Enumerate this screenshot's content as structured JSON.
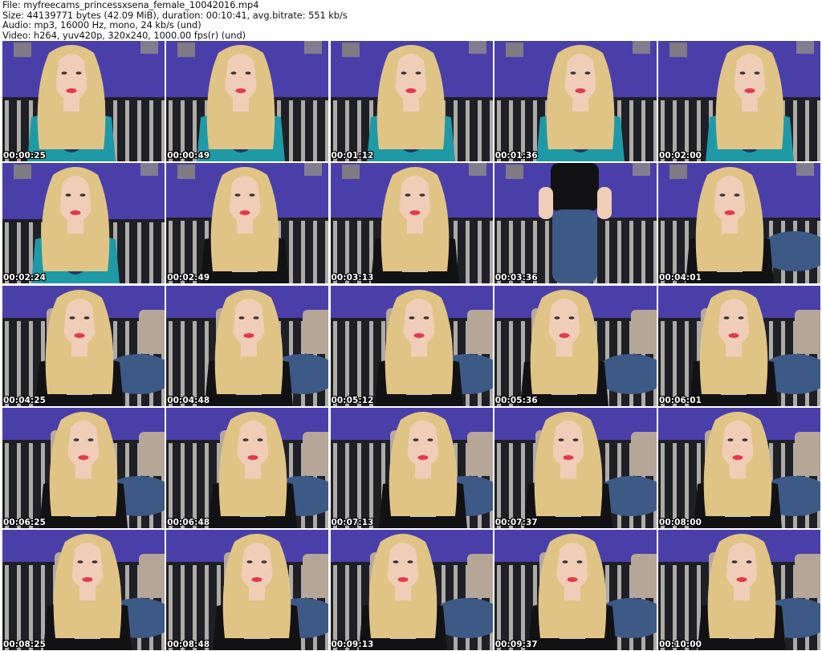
{
  "header": {
    "file": "File: myfreecams_princessxsena_female_10042016.mp4",
    "size": "Size: 44139771 bytes (42.09 MiB), duration: 00:10:41, avg.bitrate: 551 kb/s",
    "audio": "Audio: mp3, 16000 Hz, mono, 24 kb/s (und)",
    "video": "Video: h264, yuv420p, 320x240, 1000.00 fps(r) (und)"
  },
  "colors": {
    "wall": "#4a3fa8",
    "sofa_dark": "#1f1f26",
    "sofa_stripe": "#c9c4bd",
    "hair": "#e0c486",
    "skin": "#f0cdb7",
    "teal_shirt": "#1e9aa6",
    "black_shirt": "#121214",
    "jeans": "#3d5a86",
    "lips": "#e23a4c",
    "timestamp": "#ffffff"
  },
  "thumbnails": [
    {
      "time": "00:00:25",
      "outfit": "teal"
    },
    {
      "time": "00:00:49",
      "outfit": "teal"
    },
    {
      "time": "00:01:12",
      "outfit": "teal"
    },
    {
      "time": "00:01:36",
      "outfit": "teal"
    },
    {
      "time": "00:02:00",
      "outfit": "teal"
    },
    {
      "time": "00:02:24",
      "outfit": "teal"
    },
    {
      "time": "00:02:49",
      "outfit": "black"
    },
    {
      "time": "00:03:13",
      "outfit": "black"
    },
    {
      "time": "00:03:36",
      "outfit": "standing"
    },
    {
      "time": "00:04:01",
      "outfit": "black"
    },
    {
      "time": "00:04:25",
      "outfit": "black"
    },
    {
      "time": "00:04:48",
      "outfit": "black"
    },
    {
      "time": "00:05:12",
      "outfit": "black"
    },
    {
      "time": "00:05:36",
      "outfit": "black"
    },
    {
      "time": "00:06:01",
      "outfit": "black"
    },
    {
      "time": "00:06:25",
      "outfit": "black"
    },
    {
      "time": "00:06:48",
      "outfit": "black"
    },
    {
      "time": "00:07:13",
      "outfit": "black"
    },
    {
      "time": "00:07:37",
      "outfit": "black"
    },
    {
      "time": "00:08:00",
      "outfit": "black"
    },
    {
      "time": "00:08:25",
      "outfit": "black"
    },
    {
      "time": "00:08:48",
      "outfit": "black"
    },
    {
      "time": "00:09:13",
      "outfit": "black"
    },
    {
      "time": "00:09:37",
      "outfit": "black"
    },
    {
      "time": "00:10:00",
      "outfit": "black"
    }
  ]
}
